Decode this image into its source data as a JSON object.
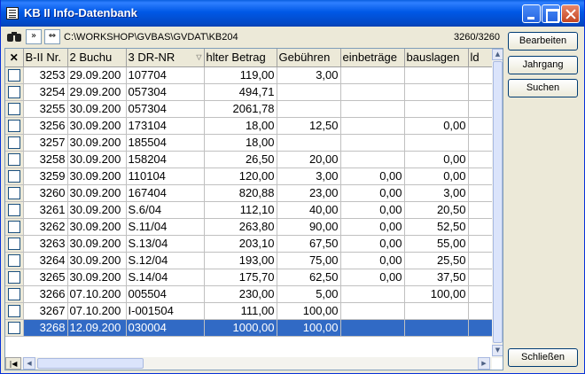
{
  "window": {
    "title": "KB II Info-Datenbank"
  },
  "toolbar": {
    "forward_label": "»",
    "swap_label": "⇔",
    "path": "C:\\WORKSHOP\\GVBAS\\GVDAT\\KB204",
    "record_count": "3260/3260"
  },
  "buttons": {
    "bearbeiten": "Bearbeiten",
    "jahrgang": "Jahrgang",
    "suchen": "Suchen",
    "schliessen": "Schließen"
  },
  "grid": {
    "headers": [
      "B-II Nr.",
      "2  Buchu",
      "3  DR-NR",
      "hlter Betrag",
      "Gebühren",
      "einbeträge",
      "bauslagen",
      "ld"
    ],
    "rows": [
      [
        "3253",
        "29.09.200",
        "107704",
        "119,00",
        "3,00",
        "",
        "",
        ""
      ],
      [
        "3254",
        "29.09.200",
        "057304",
        "494,71",
        "",
        "",
        "",
        ""
      ],
      [
        "3255",
        "30.09.200",
        "057304",
        "2061,78",
        "",
        "",
        "",
        ""
      ],
      [
        "3256",
        "30.09.200",
        "173104",
        "18,00",
        "12,50",
        "",
        "0,00",
        ""
      ],
      [
        "3257",
        "30.09.200",
        "185504",
        "18,00",
        "",
        "",
        "",
        ""
      ],
      [
        "3258",
        "30.09.200",
        "158204",
        "26,50",
        "20,00",
        "",
        "0,00",
        ""
      ],
      [
        "3259",
        "30.09.200",
        "110104",
        "120,00",
        "3,00",
        "0,00",
        "0,00",
        ""
      ],
      [
        "3260",
        "30.09.200",
        "167404",
        "820,88",
        "23,00",
        "0,00",
        "3,00",
        ""
      ],
      [
        "3261",
        "30.09.200",
        "S.6/04",
        "112,10",
        "40,00",
        "0,00",
        "20,50",
        ""
      ],
      [
        "3262",
        "30.09.200",
        "S.11/04",
        "263,80",
        "90,00",
        "0,00",
        "52,50",
        ""
      ],
      [
        "3263",
        "30.09.200",
        "S.13/04",
        "203,10",
        "67,50",
        "0,00",
        "55,00",
        ""
      ],
      [
        "3264",
        "30.09.200",
        "S.12/04",
        "193,00",
        "75,00",
        "0,00",
        "25,50",
        ""
      ],
      [
        "3265",
        "30.09.200",
        "S.14/04",
        "175,70",
        "62,50",
        "0,00",
        "37,50",
        ""
      ],
      [
        "3266",
        "07.10.200",
        "005504",
        "230,00",
        "5,00",
        "",
        "100,00",
        ""
      ],
      [
        "3267",
        "07.10.200",
        "I-001504",
        "111,00",
        "100,00",
        "",
        "",
        ""
      ],
      [
        "3268",
        "12.09.200",
        "030004",
        "1000,00",
        "100,00",
        "",
        "",
        ""
      ]
    ],
    "selected_row": 15
  },
  "icons": {
    "binoculars": "binoculars-icon",
    "close_x": "x-icon",
    "first_record": "first-record-icon"
  },
  "colors": {
    "selection": "#316ac5",
    "title_bar": "#0058e6"
  }
}
